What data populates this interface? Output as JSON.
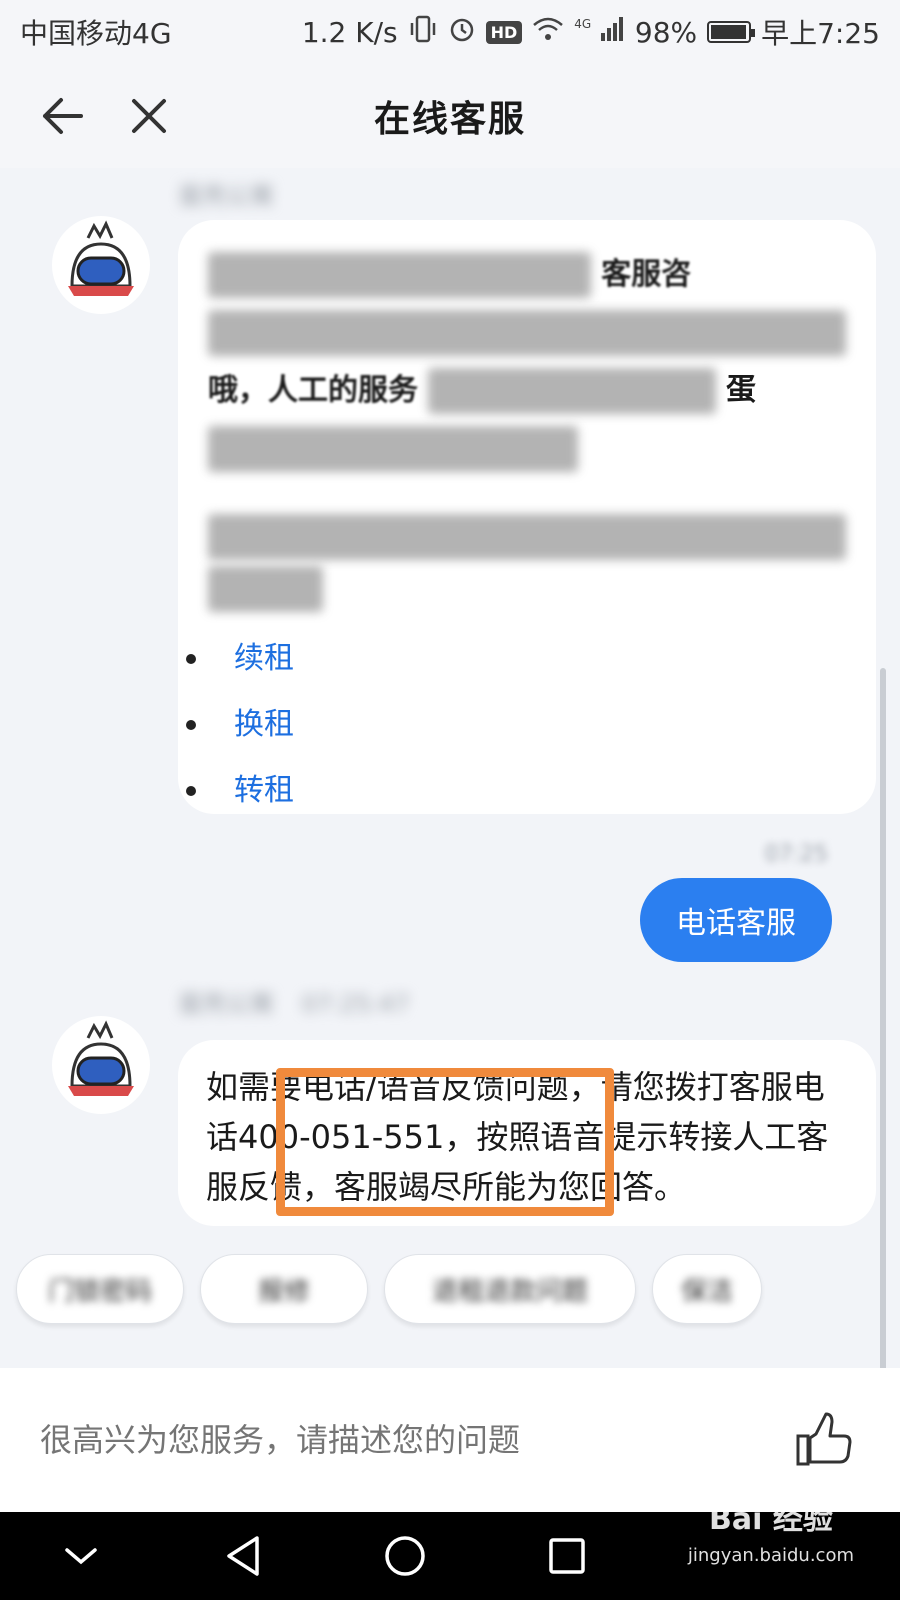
{
  "status_bar": {
    "carrier": "中国移动4G",
    "speed": "1.2 K/s",
    "hd": "HD",
    "network": "4G",
    "battery_label": "98%",
    "battery_fraction": 0.98,
    "time": "早上7:25"
  },
  "nav": {
    "back_icon": "arrow-left-icon",
    "close_icon": "close-icon",
    "title": "在线客服"
  },
  "chat": {
    "bot_name_1": "蛋壳公寓",
    "message_1": {
      "visible_fragment_1": "客服咨",
      "visible_fragment_2": "哦，人工的服务",
      "visible_fragment_3": "蛋",
      "links": [
        "续租",
        "换租",
        "转租"
      ]
    },
    "user_message": "电话客服",
    "bot_name_2": "蛋壳公寓",
    "bot_time_2": "07:25:47",
    "message_2": "如需要电话/语音反馈问题，请您拨打客服电话400-051-551，按照语音提示转接人工客服反馈，客服竭尽所能为您回答。"
  },
  "quick_replies": [
    "门锁密码",
    "报修",
    "退租退款问题",
    "保洁"
  ],
  "input": {
    "placeholder": "很高兴为您服务，请描述您的问题",
    "like_icon": "thumbs-up-icon"
  },
  "system_nav": {
    "icons": [
      "chevron-down-icon",
      "back-triangle-icon",
      "home-circle-icon",
      "recents-square-icon"
    ]
  },
  "watermark": {
    "brand": "Bai 经验",
    "url": "jingyan.baidu.com"
  },
  "colors": {
    "accent_blue": "#2b7ff0",
    "link_blue": "#1d6fe0",
    "highlight_orange": "#f08a3c",
    "background": "#f2f4f8"
  }
}
